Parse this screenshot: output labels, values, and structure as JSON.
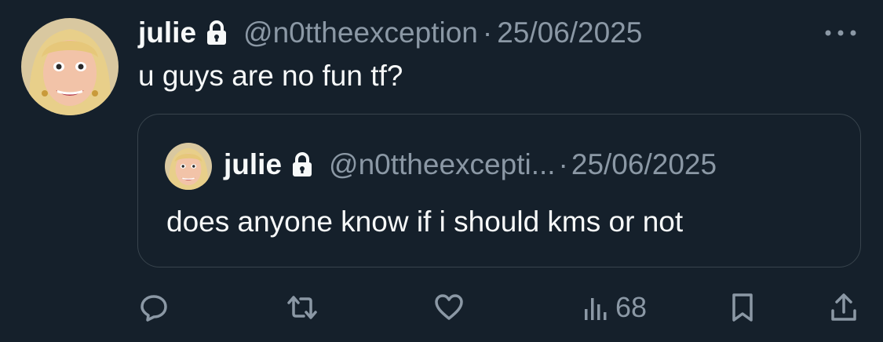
{
  "tweet": {
    "display_name": "julie",
    "handle": "@n0ttheexception",
    "separator": "·",
    "date": "25/06/2025",
    "text": "u guys are no fun tf?"
  },
  "quote": {
    "display_name": "julie",
    "handle": "@n0ttheexcepti...",
    "separator": "·",
    "date": "25/06/2025",
    "text": "does anyone know if i should kms or not"
  },
  "actions": {
    "views": "68"
  },
  "icons": {
    "lock": "lock-icon",
    "more": "more-icon",
    "reply": "reply-icon",
    "retweet": "retweet-icon",
    "like": "heart-icon",
    "views": "views-icon",
    "bookmark": "bookmark-icon",
    "share": "share-icon"
  },
  "colors": {
    "background": "#15202b",
    "text_primary": "#f7f9f9",
    "text_secondary": "#8b98a5",
    "border": "#38444d"
  }
}
